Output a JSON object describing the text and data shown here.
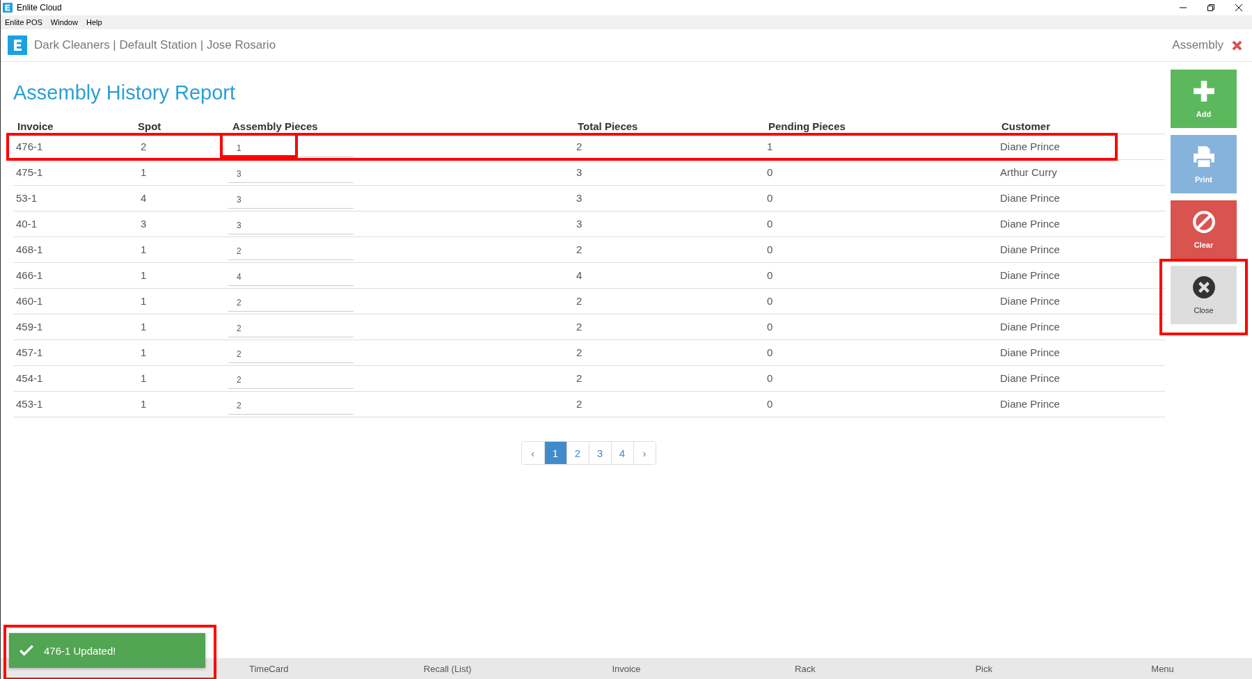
{
  "window": {
    "title": "Enlite Cloud"
  },
  "menu": [
    "Enlite POS",
    "Window",
    "Help"
  ],
  "header": {
    "context": "Dark Cleaners | Default Station | Jose Rosario",
    "module": "Assembly"
  },
  "report": {
    "title": "Assembly History Report",
    "columns": [
      "Invoice",
      "Spot",
      "Assembly Pieces",
      "Total Pieces",
      "Pending Pieces",
      "Customer"
    ],
    "rows": [
      {
        "invoice": "476-1",
        "spot": "2",
        "assembly": "1",
        "total": "2",
        "pending": "1",
        "customer": "Diane Prince",
        "highlighted": true
      },
      {
        "invoice": "475-1",
        "spot": "1",
        "assembly": "3",
        "total": "3",
        "pending": "0",
        "customer": "Arthur Curry",
        "highlighted": false
      },
      {
        "invoice": "53-1",
        "spot": "4",
        "assembly": "3",
        "total": "3",
        "pending": "0",
        "customer": "Diane Prince",
        "highlighted": false
      },
      {
        "invoice": "40-1",
        "spot": "3",
        "assembly": "3",
        "total": "3",
        "pending": "0",
        "customer": "Diane Prince",
        "highlighted": false
      },
      {
        "invoice": "468-1",
        "spot": "1",
        "assembly": "2",
        "total": "2",
        "pending": "0",
        "customer": "Diane Prince",
        "highlighted": false
      },
      {
        "invoice": "466-1",
        "spot": "1",
        "assembly": "4",
        "total": "4",
        "pending": "0",
        "customer": "Diane Prince",
        "highlighted": false
      },
      {
        "invoice": "460-1",
        "spot": "1",
        "assembly": "2",
        "total": "2",
        "pending": "0",
        "customer": "Diane Prince",
        "highlighted": false
      },
      {
        "invoice": "459-1",
        "spot": "1",
        "assembly": "2",
        "total": "2",
        "pending": "0",
        "customer": "Diane Prince",
        "highlighted": false
      },
      {
        "invoice": "457-1",
        "spot": "1",
        "assembly": "2",
        "total": "2",
        "pending": "0",
        "customer": "Diane Prince",
        "highlighted": false
      },
      {
        "invoice": "454-1",
        "spot": "1",
        "assembly": "2",
        "total": "2",
        "pending": "0",
        "customer": "Diane Prince",
        "highlighted": false
      },
      {
        "invoice": "453-1",
        "spot": "1",
        "assembly": "2",
        "total": "2",
        "pending": "0",
        "customer": "Diane Prince",
        "highlighted": false
      }
    ]
  },
  "pagination": {
    "prev": "‹",
    "next": "›",
    "pages": [
      {
        "label": "1",
        "selected": true
      },
      {
        "label": "2",
        "selected": false
      },
      {
        "label": "3",
        "selected": false
      },
      {
        "label": "4",
        "selected": false
      }
    ]
  },
  "actions": [
    {
      "kind": "add",
      "label": "Add",
      "highlighted": false
    },
    {
      "kind": "print",
      "label": "Print",
      "highlighted": false
    },
    {
      "kind": "clear",
      "label": "Clear",
      "highlighted": false
    },
    {
      "kind": "close",
      "label": "Close",
      "highlighted": true
    }
  ],
  "bottom_nav": [
    "TimeCard",
    "Recall (List)",
    "Invoice",
    "Rack",
    "Pick",
    "Menu"
  ],
  "toast": {
    "message": "476-1 Updated!",
    "highlighted": true
  }
}
